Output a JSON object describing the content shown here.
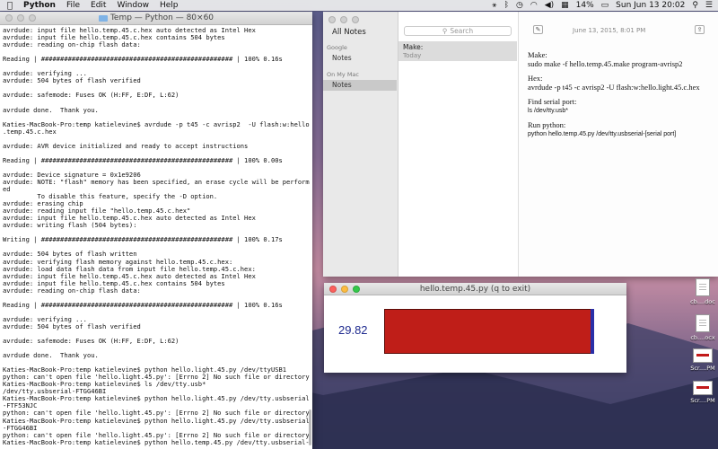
{
  "menubar": {
    "apple": "",
    "app": "Python",
    "items": [
      "File",
      "Edit",
      "Window",
      "Help"
    ],
    "battery": "14%",
    "datetime": "Sun Jun 13  20:02"
  },
  "terminal": {
    "title": "Temp — Python — 80×60",
    "lines": [
      "avrdude: input file hello.temp.45.c.hex auto detected as Intel Hex",
      "avrdude: input file hello.temp.45.c.hex contains 504 bytes",
      "avrdude: reading on-chip flash data:",
      "",
      "Reading | ################################################## | 100% 0.16s",
      "",
      "avrdude: verifying ...",
      "avrdude: 504 bytes of flash verified",
      "",
      "avrdude: safemode: Fuses OK (H:FF, E:DF, L:62)",
      "",
      "avrdude done.  Thank you.",
      "",
      "Katies-MacBook-Pro:temp katielevine$ avrdude -p t45 -c avrisp2  -U flash:w:hello",
      ".temp.45.c.hex",
      "",
      "avrdude: AVR device initialized and ready to accept instructions",
      "",
      "Reading | ################################################## | 100% 0.00s",
      "",
      "avrdude: Device signature = 0x1e9206",
      "avrdude: NOTE: \"flash\" memory has been specified, an erase cycle will be perform",
      "ed",
      "         To disable this feature, specify the -D option.",
      "avrdude: erasing chip",
      "avrdude: reading input file \"hello.temp.45.c.hex\"",
      "avrdude: input file hello.temp.45.c.hex auto detected as Intel Hex",
      "avrdude: writing flash (504 bytes):",
      "",
      "Writing | ################################################## | 100% 0.17s",
      "",
      "avrdude: 504 bytes of flash written",
      "avrdude: verifying flash memory against hello.temp.45.c.hex:",
      "avrdude: load data flash data from input file hello.temp.45.c.hex:",
      "avrdude: input file hello.temp.45.c.hex auto detected as Intel Hex",
      "avrdude: input file hello.temp.45.c.hex contains 504 bytes",
      "avrdude: reading on-chip flash data:",
      "",
      "Reading | ################################################## | 100% 0.16s",
      "",
      "avrdude: verifying ...",
      "avrdude: 504 bytes of flash verified",
      "",
      "avrdude: safemode: Fuses OK (H:FF, E:DF, L:62)",
      "",
      "avrdude done.  Thank you.",
      "",
      "Katies-MacBook-Pro:temp katielevine$ python hello.light.45.py /dev/ttyUSB1",
      "python: can't open file 'hello.light.45.py': [Errno 2] No such file or directory",
      "Katies-MacBook-Pro:temp katielevine$ ls /dev/tty.usb*",
      "/dev/tty.usbserial-FTGG46BI",
      "Katies-MacBook-Pro:temp katielevine$ python hello.light.45.py /dev/tty.usbserial",
      "-FTF53NJC",
      "python: can't open file 'hello.light.45.py': [Errno 2] No such file or directory",
      "Katies-MacBook-Pro:temp katielevine$ python hello.light.45.py /dev/tty.usbserial",
      "-FTGG46BI",
      "python: can't open file 'hello.light.45.py': [Errno 2] No such file or directory",
      "Katies-MacBook-Pro:temp katielevine$ python hello.temp.45.py /dev/tty.usbserial-",
      "FTGG46BI"
    ]
  },
  "notes": {
    "sidebar": {
      "all_notes": "All Notes",
      "groups": [
        {
          "label": "Google",
          "item": "Notes"
        },
        {
          "label": "On My Mac",
          "item": "Notes"
        }
      ]
    },
    "search_placeholder": "Search",
    "list": [
      {
        "title": "Make:",
        "date": "Today"
      }
    ],
    "editor": {
      "date": "June 13, 2015, 8:01 PM",
      "paragraphs": [
        {
          "head": "Make:",
          "body": "sudo make -f hello.temp.45.make program-avrisp2"
        },
        {
          "head": "Hex:",
          "body": "avrdude -p t45 -c avrisp2 -U flash:w:hello.light.45.c.hex"
        },
        {
          "head": "Find serial port:",
          "body": "ls /dev/tty.usb*"
        },
        {
          "head": "Run python:",
          "body": "python hello.temp.45.py /dev/tty.usbserial-[serial port]"
        }
      ]
    }
  },
  "python_window": {
    "title": "hello.temp.45.py (q to exit)",
    "value": "29.82",
    "bar_fraction": 0.99
  },
  "desktop_icons": [
    {
      "label": "cb....doc",
      "kind": "doc"
    },
    {
      "label": "cb....ocx",
      "kind": "doc"
    },
    {
      "label": "Scr....PM",
      "kind": "shot"
    },
    {
      "label": "Scr....PM",
      "kind": "shot"
    }
  ]
}
